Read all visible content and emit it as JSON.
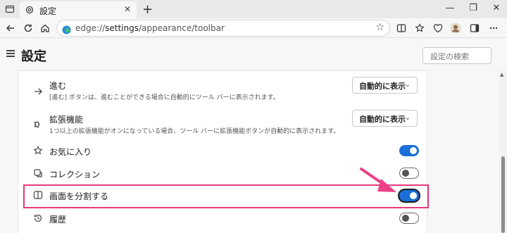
{
  "tab": {
    "title": "設定"
  },
  "address": {
    "scheme": "edge://",
    "host": "settings",
    "path": "/appearance/toolbar"
  },
  "header": {
    "title": "設定",
    "search_placeholder": "設定の検索"
  },
  "rows": [
    {
      "title": "進む",
      "description": "[進む] ボタンは、進むことができる場合に自動的にツール バーに表示されます。",
      "control": "dropdown",
      "value": "自動的に表示",
      "icon": "forward-arrow-icon"
    },
    {
      "title": "拡張機能",
      "description": "1つ以上の拡張機能がオンになっている場合、ツール バーに拡張機能ボタンが自動的に表示されます。",
      "control": "dropdown",
      "value": "自動的に表示",
      "icon": "puzzle-piece-icon"
    },
    {
      "title": "お気に入り",
      "control": "toggle",
      "on": true,
      "icon": "star-icon"
    },
    {
      "title": "コレクション",
      "control": "toggle",
      "on": false,
      "icon": "collections-icon"
    },
    {
      "title": "画面を分割する",
      "control": "toggle",
      "on": true,
      "icon": "split-screen-icon"
    },
    {
      "title": "履歴",
      "control": "toggle",
      "on": false,
      "icon": "history-icon"
    }
  ],
  "colors": {
    "accent": "#1a6fd8",
    "highlight": "#e63a7d",
    "arrow": "#ee3f87"
  }
}
